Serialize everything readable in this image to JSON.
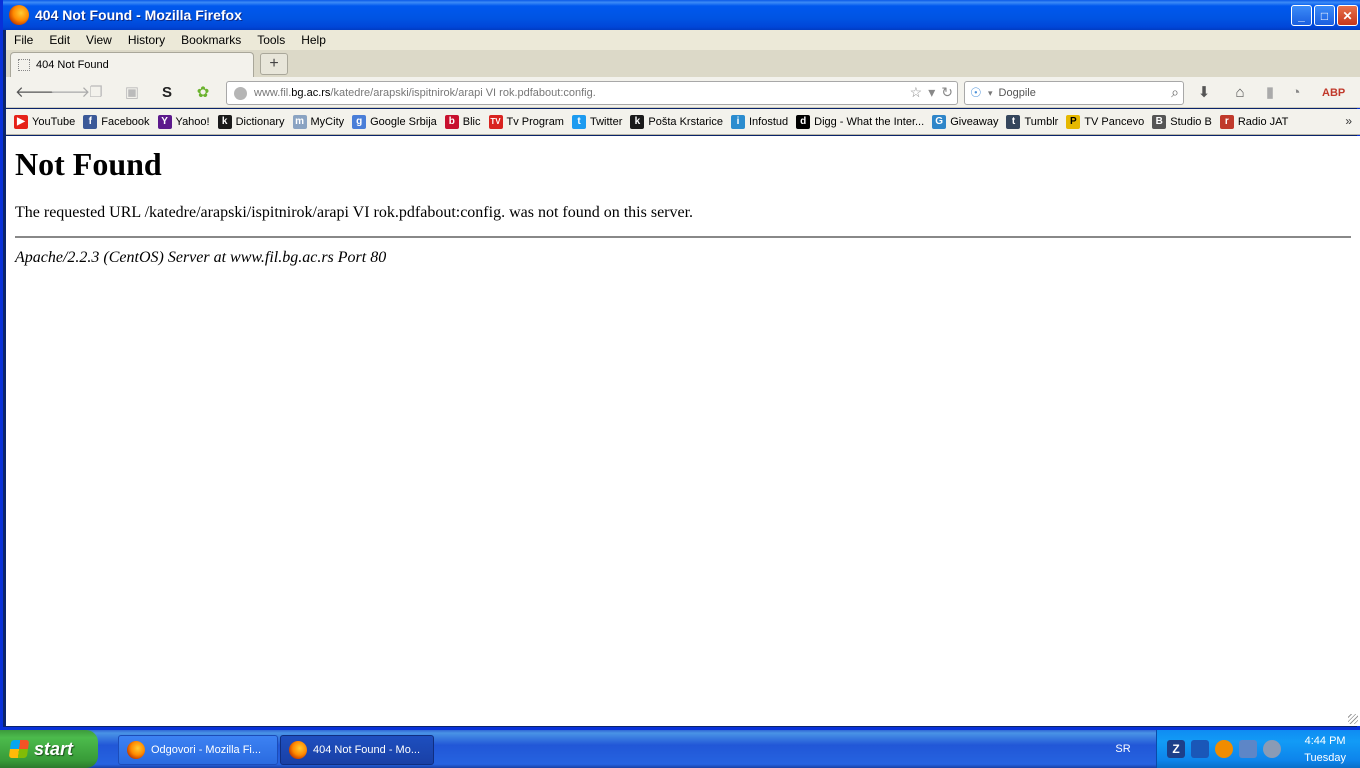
{
  "window": {
    "title": "404 Not Found - Mozilla Firefox"
  },
  "menubar": [
    "File",
    "Edit",
    "View",
    "History",
    "Bookmarks",
    "Tools",
    "Help"
  ],
  "tab": {
    "label": "404 Not Found",
    "new_tab": "+"
  },
  "navbar": {
    "url_prefix": "www.fil.",
    "url_domain": "bg.ac.rs",
    "url_path": "/katedre/arapski/ispitnirok/arapi VI rok.pdfabout:config.",
    "search_placeholder": "Dogpile"
  },
  "bookmarks": [
    {
      "label": "YouTube",
      "color": "#e62117",
      "glyph": "▶"
    },
    {
      "label": "Facebook",
      "color": "#3b5998",
      "glyph": "f"
    },
    {
      "label": "Yahoo!",
      "color": "#5c1a8c",
      "glyph": "Y"
    },
    {
      "label": "Dictionary",
      "color": "#1a1a1a",
      "glyph": "k"
    },
    {
      "label": "MyCity",
      "color": "#8aa3c2",
      "glyph": "m"
    },
    {
      "label": "Google Srbija",
      "color": "#4a7ed8",
      "glyph": "g"
    },
    {
      "label": "Blic",
      "color": "#c8102e",
      "glyph": "b"
    },
    {
      "label": "Tv Program",
      "color": "#d9231f",
      "glyph": "TV"
    },
    {
      "label": "Twitter",
      "color": "#1d9bf0",
      "glyph": "t"
    },
    {
      "label": "Pošta Krstarice",
      "color": "#1a1a1a",
      "glyph": "k"
    },
    {
      "label": "Infostud",
      "color": "#2b8ccf",
      "glyph": "i"
    },
    {
      "label": "Digg - What the Inter...",
      "color": "#000000",
      "glyph": "d"
    },
    {
      "label": "Giveaway",
      "color": "#2f86c9",
      "glyph": "G"
    },
    {
      "label": "Tumblr",
      "color": "#35465c",
      "glyph": "t"
    },
    {
      "label": "TV Pancevo",
      "color": "#e6b800",
      "glyph": "P"
    },
    {
      "label": "Studio B",
      "color": "#555555",
      "glyph": "B"
    },
    {
      "label": "Radio JAT",
      "color": "#c0392b",
      "glyph": "r"
    }
  ],
  "bookmarks_more": "»",
  "page": {
    "heading": "Not Found",
    "message": "The requested URL /katedre/arapski/ispitnirok/arapi VI rok.pdfabout:config. was not found on this server.",
    "address": "Apache/2.2.3 (CentOS) Server at www.fil.bg.ac.rs Port 80"
  },
  "taskbar": {
    "start": "start",
    "tasks": [
      "Odgovori - Mozilla Fi...",
      "404 Not Found - Mo..."
    ],
    "language": "SR",
    "time": "4:44 PM",
    "day": "Tuesday"
  }
}
